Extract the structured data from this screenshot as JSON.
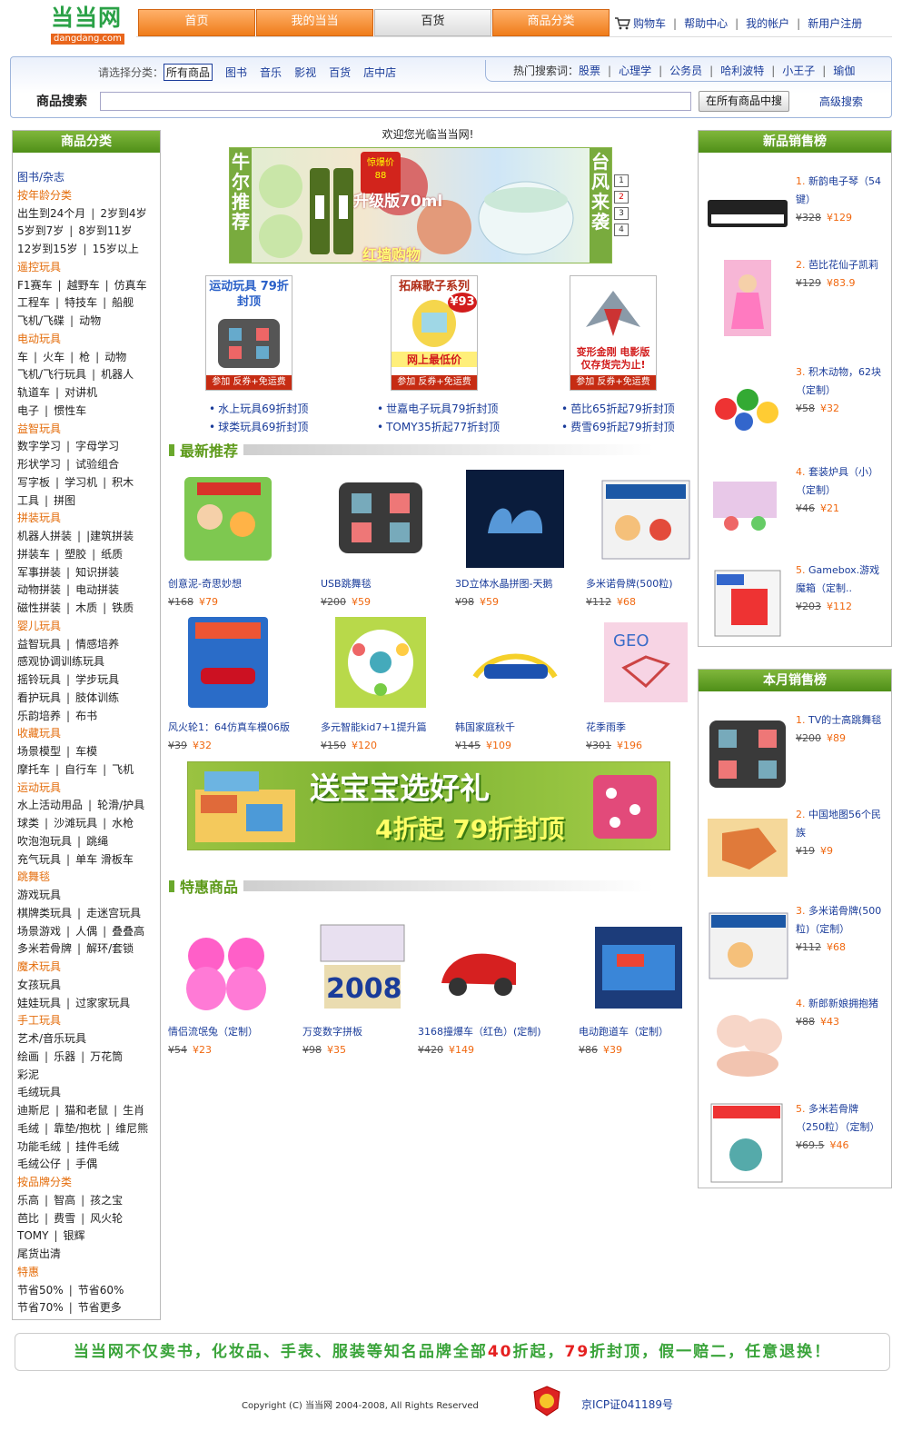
{
  "header": {
    "logo_cn": "当当网",
    "logo_en": "dangdang.com",
    "nav_tabs": [
      "首页",
      "我的当当",
      "百货",
      "商品分类"
    ],
    "links": [
      "购物车",
      "帮助中心",
      "我的帐户",
      "新用户注册"
    ]
  },
  "search": {
    "cat_prompt": "请选择分类：",
    "categories": [
      "所有商品",
      "图书",
      "音乐",
      "影视",
      "百货",
      "店中店"
    ],
    "hot_label": "热门搜索词：",
    "hot_words": [
      "股票",
      "心理学",
      "公务员",
      "哈利波特",
      "小王子",
      "瑜伽"
    ],
    "label": "商品搜索",
    "input_value": "",
    "button": "在所有商品中搜",
    "advanced": "高级搜索"
  },
  "left": {
    "title": "商品分类",
    "rows": [
      {
        "type": "first",
        "items": [
          "图书/杂志"
        ]
      },
      {
        "type": "head",
        "items": [
          "按年龄分类"
        ]
      },
      {
        "type": "item",
        "items": [
          "出生到24个月",
          "2岁到4岁"
        ]
      },
      {
        "type": "item",
        "items": [
          "5岁到7岁",
          "8岁到11岁"
        ]
      },
      {
        "type": "item",
        "items": [
          "12岁到15岁",
          "15岁以上"
        ]
      },
      {
        "type": "head",
        "items": [
          "遥控玩具"
        ]
      },
      {
        "type": "item",
        "items": [
          "F1赛车",
          "越野车",
          "仿真车"
        ]
      },
      {
        "type": "item",
        "items": [
          "工程车",
          "特技车",
          "船舰"
        ]
      },
      {
        "type": "item",
        "items": [
          "飞机/飞碟",
          "动物"
        ]
      },
      {
        "type": "head",
        "items": [
          "电动玩具"
        ]
      },
      {
        "type": "item",
        "items": [
          "车",
          "火车",
          "枪",
          "动物"
        ]
      },
      {
        "type": "item",
        "items": [
          "飞机/飞行玩具",
          "机器人"
        ]
      },
      {
        "type": "item",
        "items": [
          "轨道车",
          "对讲机"
        ]
      },
      {
        "type": "item",
        "items": [
          "电子",
          "惯性车"
        ]
      },
      {
        "type": "head",
        "items": [
          "益智玩具"
        ]
      },
      {
        "type": "item",
        "items": [
          "数字学习",
          "字母学习"
        ]
      },
      {
        "type": "item",
        "items": [
          "形状学习",
          "试验组合"
        ]
      },
      {
        "type": "item",
        "items": [
          "写字板",
          "学习机",
          "积木"
        ]
      },
      {
        "type": "item",
        "items": [
          "工具",
          "拼图"
        ]
      },
      {
        "type": "head",
        "items": [
          "拼装玩具"
        ]
      },
      {
        "type": "item",
        "items": [
          "机器人拼装",
          "|建筑拼装"
        ]
      },
      {
        "type": "item",
        "items": [
          "拼装车",
          "塑胶",
          "纸质"
        ]
      },
      {
        "type": "item",
        "items": [
          "军事拼装",
          "知识拼装"
        ]
      },
      {
        "type": "item",
        "items": [
          "动物拼装",
          "电动拼装"
        ]
      },
      {
        "type": "item",
        "items": [
          "磁性拼装",
          "木质",
          "铁质"
        ]
      },
      {
        "type": "head",
        "items": [
          "婴儿玩具"
        ]
      },
      {
        "type": "item",
        "items": [
          "益智玩具",
          "情感培养"
        ]
      },
      {
        "type": "item",
        "items": [
          "感观协调训练玩具"
        ]
      },
      {
        "type": "item",
        "items": [
          "摇铃玩具",
          "学步玩具"
        ]
      },
      {
        "type": "item",
        "items": [
          "看护玩具",
          "肢体训练"
        ]
      },
      {
        "type": "item",
        "items": [
          "乐韵培养",
          "布书"
        ]
      },
      {
        "type": "head",
        "items": [
          "收藏玩具"
        ]
      },
      {
        "type": "item",
        "items": [
          "场景模型",
          "车模"
        ]
      },
      {
        "type": "item",
        "items": [
          "摩托车",
          "自行车",
          "飞机"
        ]
      },
      {
        "type": "head",
        "items": [
          "运动玩具"
        ]
      },
      {
        "type": "item",
        "items": [
          "水上活动用品",
          "轮滑/护具"
        ]
      },
      {
        "type": "item",
        "items": [
          "球类",
          "沙滩玩具",
          "水枪"
        ]
      },
      {
        "type": "item",
        "items": [
          "吹泡泡玩具",
          "跳绳"
        ]
      },
      {
        "type": "item",
        "items": [
          "充气玩具",
          "单车 滑板车"
        ]
      },
      {
        "type": "head",
        "items": [
          "跳舞毯"
        ]
      },
      {
        "type": "item",
        "items": [
          "游戏玩具"
        ]
      },
      {
        "type": "item",
        "items": [
          "棋牌类玩具",
          "走迷宫玩具"
        ]
      },
      {
        "type": "item",
        "items": [
          "场景游戏",
          "人偶",
          "叠叠高"
        ]
      },
      {
        "type": "item",
        "items": [
          "多米若骨牌",
          "解环/套锁"
        ]
      },
      {
        "type": "head",
        "items": [
          "魔术玩具"
        ]
      },
      {
        "type": "item",
        "items": [
          "女孩玩具"
        ]
      },
      {
        "type": "item",
        "items": [
          "娃娃玩具",
          "过家家玩具"
        ]
      },
      {
        "type": "head",
        "items": [
          "手工玩具"
        ]
      },
      {
        "type": "item",
        "items": [
          "艺术/音乐玩具"
        ]
      },
      {
        "type": "item",
        "items": [
          "绘画",
          "乐器",
          "万花筒"
        ]
      },
      {
        "type": "item",
        "items": [
          "彩泥"
        ]
      },
      {
        "type": "item",
        "items": [
          "毛绒玩具"
        ]
      },
      {
        "type": "item",
        "items": [
          "迪斯尼",
          "猫和老鼠",
          "生肖"
        ]
      },
      {
        "type": "item",
        "items": [
          "毛绒",
          "靠垫/抱枕",
          "维尼熊"
        ]
      },
      {
        "type": "item",
        "items": [
          "功能毛绒",
          "挂件毛绒"
        ]
      },
      {
        "type": "item",
        "items": [
          "毛绒公仔",
          "手偶"
        ]
      },
      {
        "type": "head",
        "items": [
          "按品牌分类"
        ]
      },
      {
        "type": "item",
        "items": [
          "乐高",
          "智高",
          "孩之宝"
        ]
      },
      {
        "type": "item",
        "items": [
          "芭比",
          "费雪",
          "风火轮"
        ]
      },
      {
        "type": "item",
        "items": [
          "TOMY",
          "银辉"
        ]
      },
      {
        "type": "item",
        "items": [
          "尾货出清"
        ]
      },
      {
        "type": "head",
        "items": [
          "特惠"
        ]
      },
      {
        "type": "item",
        "items": [
          "节省50%",
          "节省60%"
        ]
      },
      {
        "type": "item",
        "items": [
          "节省70%",
          "节省更多"
        ]
      }
    ]
  },
  "center": {
    "welcome": "欢迎您光临当当网!",
    "banner": {
      "left_text": "牛尔推荐",
      "right_text": "台风来袭",
      "price_tag": "惊爆价 88",
      "sub": "升级版70ml",
      "shop": "红墙购物",
      "nums": [
        "1",
        "2",
        "3",
        "4"
      ]
    },
    "promos": [
      {
        "title": "运动玩具 79折封顶",
        "badge": "",
        "footer": "参加 反券+免运费"
      },
      {
        "title": "拓麻歌子系列",
        "badge": "¥93",
        "sub": "网上最低价",
        "footer": "参加 反券+免运费"
      },
      {
        "title": "",
        "badge": "",
        "sub": "变形金刚 电影版 仅存货完为止!",
        "footer": "参加 反券+免运费"
      }
    ],
    "promo_links": [
      [
        "水上玩具69折封顶",
        "球类玩具69折封顶"
      ],
      [
        "世嘉电子玩具79折封顶",
        "TOMY35折起77折封顶"
      ],
      [
        "芭比65折起79折封顶",
        "费雪69折起79折封顶"
      ]
    ],
    "sec1": "最新推荐",
    "products1": [
      {
        "name": "创意泥-奇思妙想",
        "old": "¥168",
        "new": "¥79"
      },
      {
        "name": "USB跳舞毯",
        "old": "¥200",
        "new": "¥59"
      },
      {
        "name": "3D立体水晶拼图-天鹅",
        "old": "¥98",
        "new": "¥59"
      },
      {
        "name": "多米诺骨牌(500粒)",
        "old": "¥112",
        "new": "¥68"
      },
      {
        "name": "风火轮1：64仿真车模06版",
        "old": "¥39",
        "new": "¥32"
      },
      {
        "name": "多元智能kid7+1提升篇",
        "old": "¥150",
        "new": "¥120"
      },
      {
        "name": "韩国家庭秋千",
        "old": "¥145",
        "new": "¥109"
      },
      {
        "name": "花季雨季",
        "old": "¥301",
        "new": "¥196"
      }
    ],
    "gift": {
      "line1": "送宝宝选好礼",
      "line2": "4折起 79折封顶"
    },
    "sec2": "特惠商品",
    "products2": [
      {
        "name": "情侣流氓兔（定制）",
        "old": "¥54",
        "new": "¥23"
      },
      {
        "name": "万变数字拼板",
        "old": "¥98",
        "new": "¥35",
        "img_text": "2008"
      },
      {
        "name": "3168撞爆车（红色）(定制)",
        "old": "¥420",
        "new": "¥149"
      },
      {
        "name": "电动跑道车（定制）",
        "old": "¥86",
        "new": "¥39"
      }
    ]
  },
  "right": {
    "title1": "新品销售榜",
    "list1": [
      {
        "no": "1.",
        "name": "新韵电子琴（54键）",
        "old": "¥328",
        "new": "¥129"
      },
      {
        "no": "2.",
        "name": "芭比花仙子凯莉",
        "old": "¥129",
        "new": "¥83.9"
      },
      {
        "no": "3.",
        "name": "积木动物，62块（定制）",
        "old": "¥58",
        "new": "¥32"
      },
      {
        "no": "4.",
        "name": "套装炉具（小）（定制）",
        "old": "¥46",
        "new": "¥21"
      },
      {
        "no": "5.",
        "name": "Gamebox.游戏魔箱（定制..",
        "old": "¥203",
        "new": "¥112"
      }
    ],
    "title2": "本月销售榜",
    "list2": [
      {
        "no": "1.",
        "name": "TV的士高跳舞毯",
        "old": "¥200",
        "new": "¥89"
      },
      {
        "no": "2.",
        "name": "中国地图56个民族",
        "old": "¥19",
        "new": "¥9"
      },
      {
        "no": "3.",
        "name": "多米诺骨牌(500粒)（定制）",
        "old": "¥112",
        "new": "¥68"
      },
      {
        "no": "4.",
        "name": "新郎新娘拥抱猪",
        "old": "¥88",
        "new": "¥43"
      },
      {
        "no": "5.",
        "name": "多米若骨牌（250粒）（定制）",
        "old": "¥69.5",
        "new": "¥46"
      }
    ]
  },
  "footer": {
    "slogan_a": "当当网不仅卖书，化妆品、手表、服装等知名品牌全部",
    "slogan_b": "40",
    "slogan_c": "折起，",
    "slogan_d": "79",
    "slogan_e": "折封顶，假一赔二，任意退换！",
    "copyright": "Copyright (C) 当当网 2004-2008, All Rights Reserved",
    "icp": "京ICP证041189号"
  }
}
